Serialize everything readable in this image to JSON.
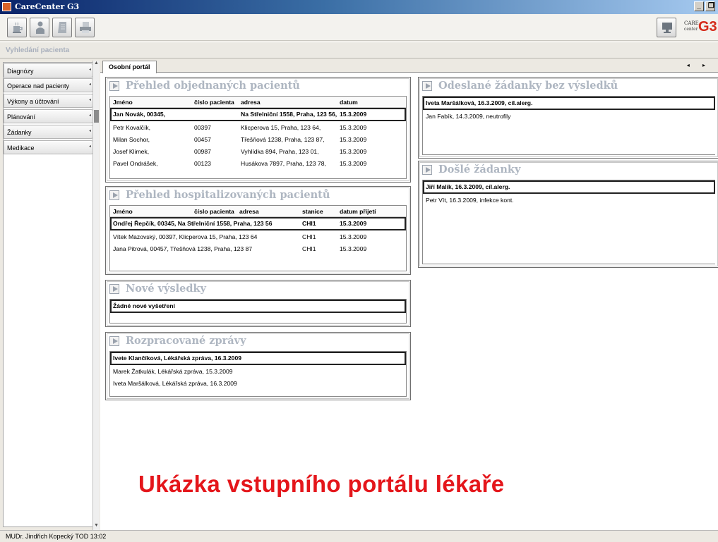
{
  "window": {
    "title": "CareCenter G3",
    "min_label": "_",
    "max_label": " ❒"
  },
  "toolbar": {
    "buttons": [
      "coffee-cup-icon",
      "person-icon",
      "document-icon",
      "printer-icon"
    ],
    "right_button": "monitor-icon",
    "logo": {
      "care": "CARE",
      "center": "center",
      "g3": "G3"
    }
  },
  "search": {
    "placeholder": "Vyhledání pacienta"
  },
  "sidebar": {
    "items": [
      {
        "label": "Diagnózy"
      },
      {
        "label": "Operace nad pacienty"
      },
      {
        "label": "Výkony a účtování"
      },
      {
        "label": "Plánování"
      },
      {
        "label": "Žádanky"
      },
      {
        "label": "Medikace"
      }
    ]
  },
  "tabs": {
    "active": "Osobní portál",
    "arrows": "◂ ▸"
  },
  "ordered": {
    "title": "Přehled objednaných pacientů",
    "headers": [
      "Jméno",
      "číslo pacienta",
      "adresa",
      "datum"
    ],
    "selected": {
      "name": "Jan Novák, 00345,",
      "address": "Na Střelniční 1558, Praha, 123 56,",
      "date": "15.3.2009"
    },
    "rows": [
      [
        "Petr Kovalčík,",
        "00397",
        "Klicperova 15, Praha, 123 64,",
        "15.3.2009"
      ],
      [
        "Milan Sochor,",
        "00457",
        "Třešňová 1238, Praha, 123 87,",
        "15.3.2009"
      ],
      [
        "Josef Klimek,",
        "00987",
        "Vyhlídka 894, Praha, 123 01,",
        "15.3.2009"
      ],
      [
        "Pavel Ondrášek,",
        "00123",
        "Husákova 7897, Praha, 123 78,",
        "15.3.2009"
      ]
    ]
  },
  "hospitalized": {
    "title": "Přehled hospitalizovaných pacientů",
    "headers": [
      "Jméno",
      "číslo pacienta",
      "adresa",
      "stanice",
      "datum přijetí"
    ],
    "selected": {
      "name": "Ondřej Řepčík, 00345, Na Střelniční 1558, Praha, 123 56",
      "station": "CHI1",
      "date": "15.3.2009"
    },
    "rows": [
      [
        "Vítek Mazovský, 00397, Klicperova 15, Praha, 123 64",
        "CHI1",
        "15.3.2009"
      ],
      [
        "Jana Pitrová, 00457, Třešňová 1238, Praha, 123 87",
        "CHI1",
        "15.3.2009"
      ]
    ]
  },
  "new_results": {
    "title": "Nové výsledky",
    "selected": "Žádné nové vyšetření"
  },
  "drafts": {
    "title": "Rozpracované zprávy",
    "selected": "Ivete Klančíková, Lékářská zpráva, 16.3.2009",
    "rows": [
      "Marek Žatkulák, Lékářská zpráva, 15.3.2009",
      "Iveta Maršálková, Lékářská zpráva, 16.3.2009"
    ]
  },
  "sent_requests": {
    "title": "Odeslané žádanky bez výsledků",
    "selected": "Iveta Maršálková, 16.3.2009, cíl.alerg.",
    "rows": [
      "Jan Fabík, 14.3.2009, neutrofily"
    ]
  },
  "received_requests": {
    "title": "Došlé žádanky",
    "selected": "Jiří Malík, 16.3.2009, cíl.alerg.",
    "rows": [
      "Petr Vít, 16.3.2009, infekce kont."
    ]
  },
  "banner": "Ukázka vstupního portálu lékaře",
  "status": "MUDr. Jindřich Kopecký  TOD  13:02",
  "colors": {
    "accent_red": "#e4161b",
    "title_blue": "#0a246a",
    "panel_title": "#aeb6c1"
  }
}
